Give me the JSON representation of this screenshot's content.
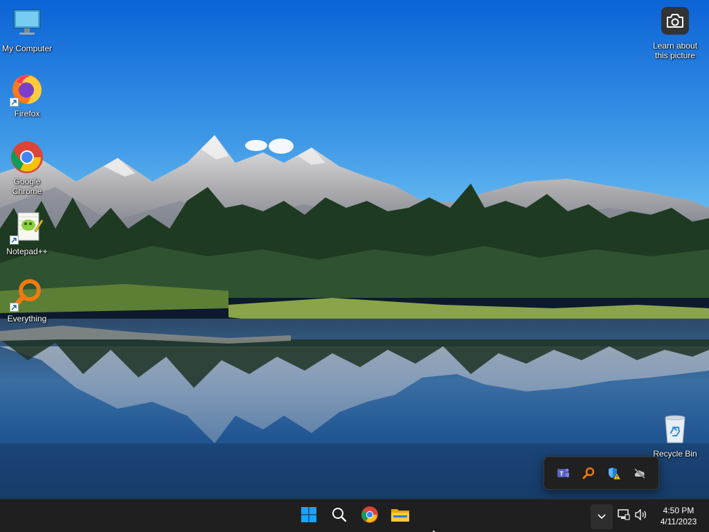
{
  "desktop": {
    "icons": [
      {
        "label": "My Computer",
        "icon": "monitor-icon"
      },
      {
        "label": "Firefox",
        "icon": "firefox-icon"
      },
      {
        "label": "Google Chrome",
        "icon": "chrome-icon"
      },
      {
        "label": "Notepad++",
        "icon": "notepad-plus-plus-icon"
      },
      {
        "label": "Everything",
        "icon": "everything-search-icon"
      },
      {
        "label": "Recycle Bin",
        "icon": "recycle-bin-icon"
      }
    ],
    "spotlight": {
      "label_line1": "Learn about",
      "label_line2": "this picture",
      "icon": "camera-icon"
    }
  },
  "tray_flyout": {
    "items": [
      {
        "icon": "teams-icon"
      },
      {
        "icon": "everything-tray-icon"
      },
      {
        "icon": "security-warning-icon"
      },
      {
        "icon": "onedrive-offline-icon"
      }
    ]
  },
  "taskbar": {
    "pinned": [
      {
        "icon": "windows-start-icon"
      },
      {
        "icon": "search-icon"
      },
      {
        "icon": "chrome-icon"
      },
      {
        "icon": "file-explorer-icon"
      }
    ],
    "system": [
      "network-icon",
      "volume-icon"
    ],
    "clock": {
      "time": "4:50 PM",
      "date": "4/11/2023"
    }
  },
  "colors": {
    "taskbar": "#1f1f1f",
    "sky_top": "#0b63d6",
    "sky_bottom": "#5ab4ee",
    "accent": "#0078d4"
  }
}
